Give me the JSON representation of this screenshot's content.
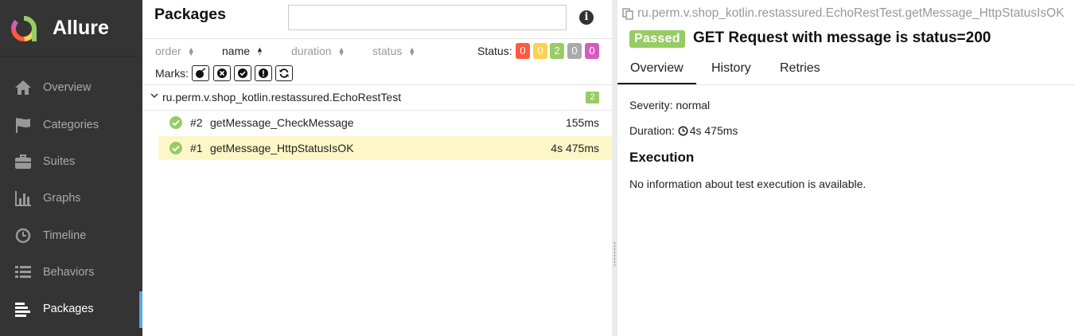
{
  "app": {
    "name": "Allure"
  },
  "sidebar": {
    "items": [
      {
        "label": "Overview",
        "icon": "home-icon",
        "active": false
      },
      {
        "label": "Categories",
        "icon": "flag-icon",
        "active": false
      },
      {
        "label": "Suites",
        "icon": "briefcase-icon",
        "active": false
      },
      {
        "label": "Graphs",
        "icon": "bar-chart-icon",
        "active": false
      },
      {
        "label": "Timeline",
        "icon": "clock-icon",
        "active": false
      },
      {
        "label": "Behaviors",
        "icon": "list-icon",
        "active": false
      },
      {
        "label": "Packages",
        "icon": "align-left-icon",
        "active": true
      }
    ]
  },
  "packages": {
    "title": "Packages",
    "search": {
      "value": "",
      "placeholder": ""
    },
    "sort": {
      "order": "order",
      "name": "name",
      "duration": "duration",
      "status": "status",
      "active": "name"
    },
    "status_label": "Status:",
    "status_counts": [
      {
        "value": "0",
        "status": "failed",
        "color": "#fd5a3e"
      },
      {
        "value": "0",
        "status": "broken",
        "color": "#ffd050"
      },
      {
        "value": "2",
        "status": "passed",
        "color": "#97cc64"
      },
      {
        "value": "0",
        "status": "skipped",
        "color": "#aaaaaa"
      },
      {
        "value": "0",
        "status": "unknown",
        "color": "#d35ebe"
      }
    ],
    "marks_label": "Marks:",
    "marks": [
      "bomb-icon",
      "times-circle-icon",
      "check-circle-icon",
      "exclamation-circle-icon",
      "refresh-icon"
    ],
    "group": {
      "name": "ru.perm.v.shop_kotlin.restassured.EchoRestTest",
      "count": "2"
    },
    "rows": [
      {
        "num": "#2",
        "name": "getMessage_CheckMessage",
        "duration": "155ms",
        "selected": false
      },
      {
        "num": "#1",
        "name": "getMessage_HttpStatusIsOK",
        "duration": "4s 475ms",
        "selected": true
      }
    ]
  },
  "detail": {
    "breadcrumb": "ru.perm.v.shop_kotlin.restassured.EchoRestTest.getMessage_HttpStatusIsOK",
    "status": "Passed",
    "title": "GET Request with message is status=200",
    "tabs": [
      "Overview",
      "History",
      "Retries"
    ],
    "severity": "Severity: normal",
    "duration_label": "Duration:",
    "duration_value": "4s 475ms",
    "execution_title": "Execution",
    "execution_text": "No information about test execution is available."
  },
  "colors": {
    "sidebar_bg": "#343434",
    "passed": "#97cc64",
    "selected_row": "#fdf7c8",
    "active_indicator": "#5aa7e8"
  }
}
